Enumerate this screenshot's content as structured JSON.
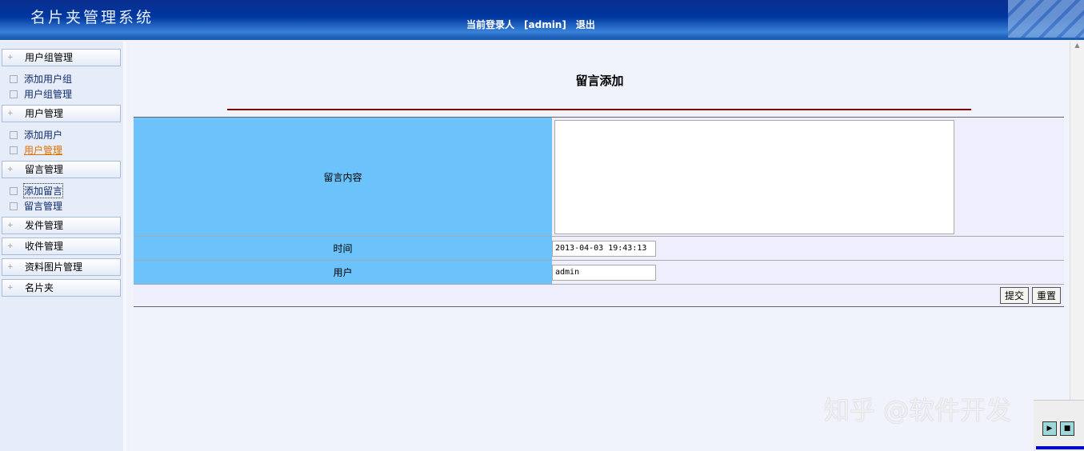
{
  "header": {
    "title": "名片夹管理系统",
    "login_label": "当前登录人",
    "user": "[admin]",
    "logout": "退出"
  },
  "sidebar": {
    "groups": [
      {
        "label": "用户组管理",
        "items": [
          "添加用户组",
          "用户组管理"
        ]
      },
      {
        "label": "用户管理",
        "items": [
          "添加用户",
          "用户管理"
        ]
      },
      {
        "label": "留言管理",
        "items": [
          "添加留言",
          "留言管理"
        ]
      },
      {
        "label": "发件管理",
        "items": []
      },
      {
        "label": "收件管理",
        "items": []
      },
      {
        "label": "资料图片管理",
        "items": []
      },
      {
        "label": "名片夹",
        "items": []
      }
    ]
  },
  "main": {
    "title": "留言添加",
    "fields": {
      "content_label": "留言内容",
      "content_value": "",
      "time_label": "时间",
      "time_value": "2013-04-03 19:43:13",
      "user_label": "用户",
      "user_value": "admin"
    },
    "submit": "提交",
    "reset": "重置"
  },
  "watermark": "知乎 @软件开发"
}
